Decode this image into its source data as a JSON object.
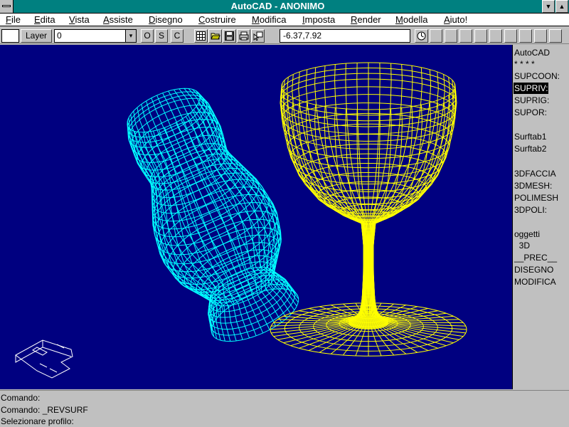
{
  "window": {
    "title": "AutoCAD - ANONIMO",
    "minimize_glyph": "▼",
    "maximize_glyph": "▲"
  },
  "menubar": {
    "items": [
      "File",
      "Edita",
      "Vista",
      "Assiste",
      "Disegno",
      "Costruire",
      "Modifica",
      "Imposta",
      "Render",
      "Modella",
      "Aiuto!"
    ]
  },
  "toolbar": {
    "layer_label": "Layer",
    "layer_value": "0",
    "dropdown_glyph": "▾",
    "ortho": "O",
    "snap": "S",
    "coords_toggle": "C",
    "coordinates": "-6.37,7.92",
    "icons": [
      "grid-icon",
      "open-folder-icon",
      "save-disk-icon",
      "print-icon",
      "pointer-icon",
      "aerial-view-icon"
    ]
  },
  "screen_menu": {
    "items": [
      "AutoCAD",
      "* * * *",
      "SUPCOON:",
      "SUPRIV:",
      "SUPRIG:",
      "SUPOR:",
      "",
      "Surftab1",
      "Surftab2",
      "",
      "3DFACCIA",
      "3DMESH:",
      "POLIMESH",
      "3DPOLI:",
      "",
      "oggetti",
      "  3D",
      "__PREC__",
      "DISEGNO",
      "MODIFICA"
    ],
    "highlighted": "SUPRIV:"
  },
  "command": {
    "lines": [
      "Comando:",
      "Comando: _REVSURF",
      "Selezionare profilo:"
    ]
  },
  "colors": {
    "drawing_bg": "#000080",
    "goblet": "#ffff00",
    "vase": "#00ffff",
    "title_bg": "#008080",
    "ucs_icon": "#ffffff"
  }
}
